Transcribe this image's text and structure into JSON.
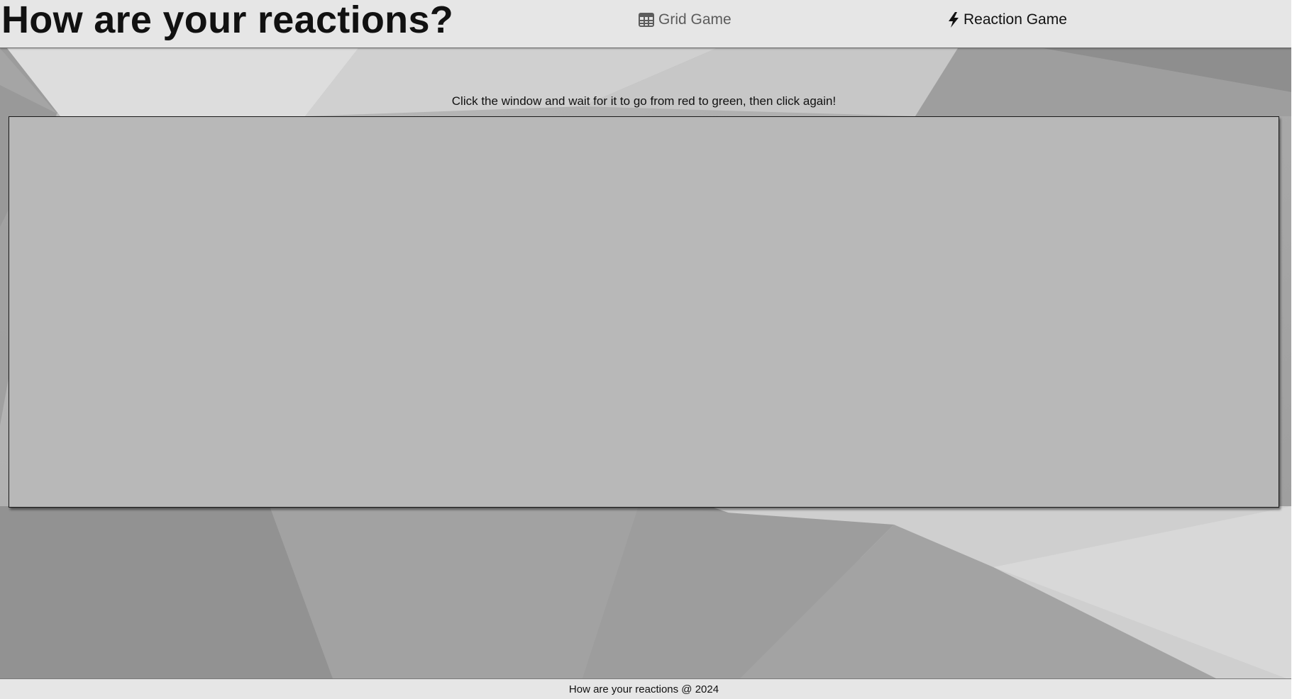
{
  "header": {
    "title": "How are your reactions?",
    "nav": [
      {
        "label": "Grid Game",
        "icon": "grid-icon",
        "active": false
      },
      {
        "label": "Reaction Game",
        "icon": "lightning-bolt-icon",
        "active": true
      }
    ]
  },
  "main": {
    "instructions": "Click the window and wait for it to go from red to green, then click again!",
    "game_window_color": "#b8b8b8"
  },
  "footer": {
    "text": "How are your reactions @ 2024"
  },
  "colors": {
    "header_bg": "#e6e6e6",
    "inactive_nav": "#5c5c5c",
    "active_nav": "#111111"
  }
}
